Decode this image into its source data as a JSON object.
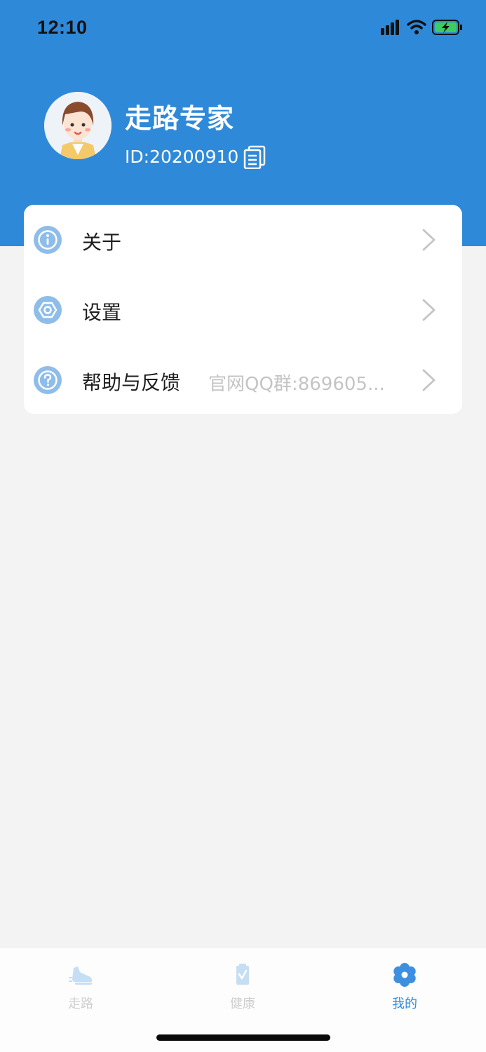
{
  "status_bar": {
    "time": "12:10"
  },
  "profile": {
    "name": "走路专家",
    "id_text": "ID:20200910"
  },
  "menu": [
    {
      "label": "关于",
      "value": "",
      "icon": "info-icon"
    },
    {
      "label": "设置",
      "value": "",
      "icon": "settings-hex-icon"
    },
    {
      "label": "帮助与反馈",
      "value": "官网QQ群:869605...",
      "icon": "help-icon"
    }
  ],
  "tabs": [
    {
      "label": "走路",
      "icon": "shoe-icon",
      "active": false
    },
    {
      "label": "健康",
      "icon": "health-icon",
      "active": false
    },
    {
      "label": "我的",
      "icon": "flower-icon",
      "active": true
    }
  ],
  "colors": {
    "brand": "#2f89d9",
    "icon_light": "#8fbde9",
    "muted_text": "#c4c4c4",
    "background": "#f3f3f3"
  }
}
